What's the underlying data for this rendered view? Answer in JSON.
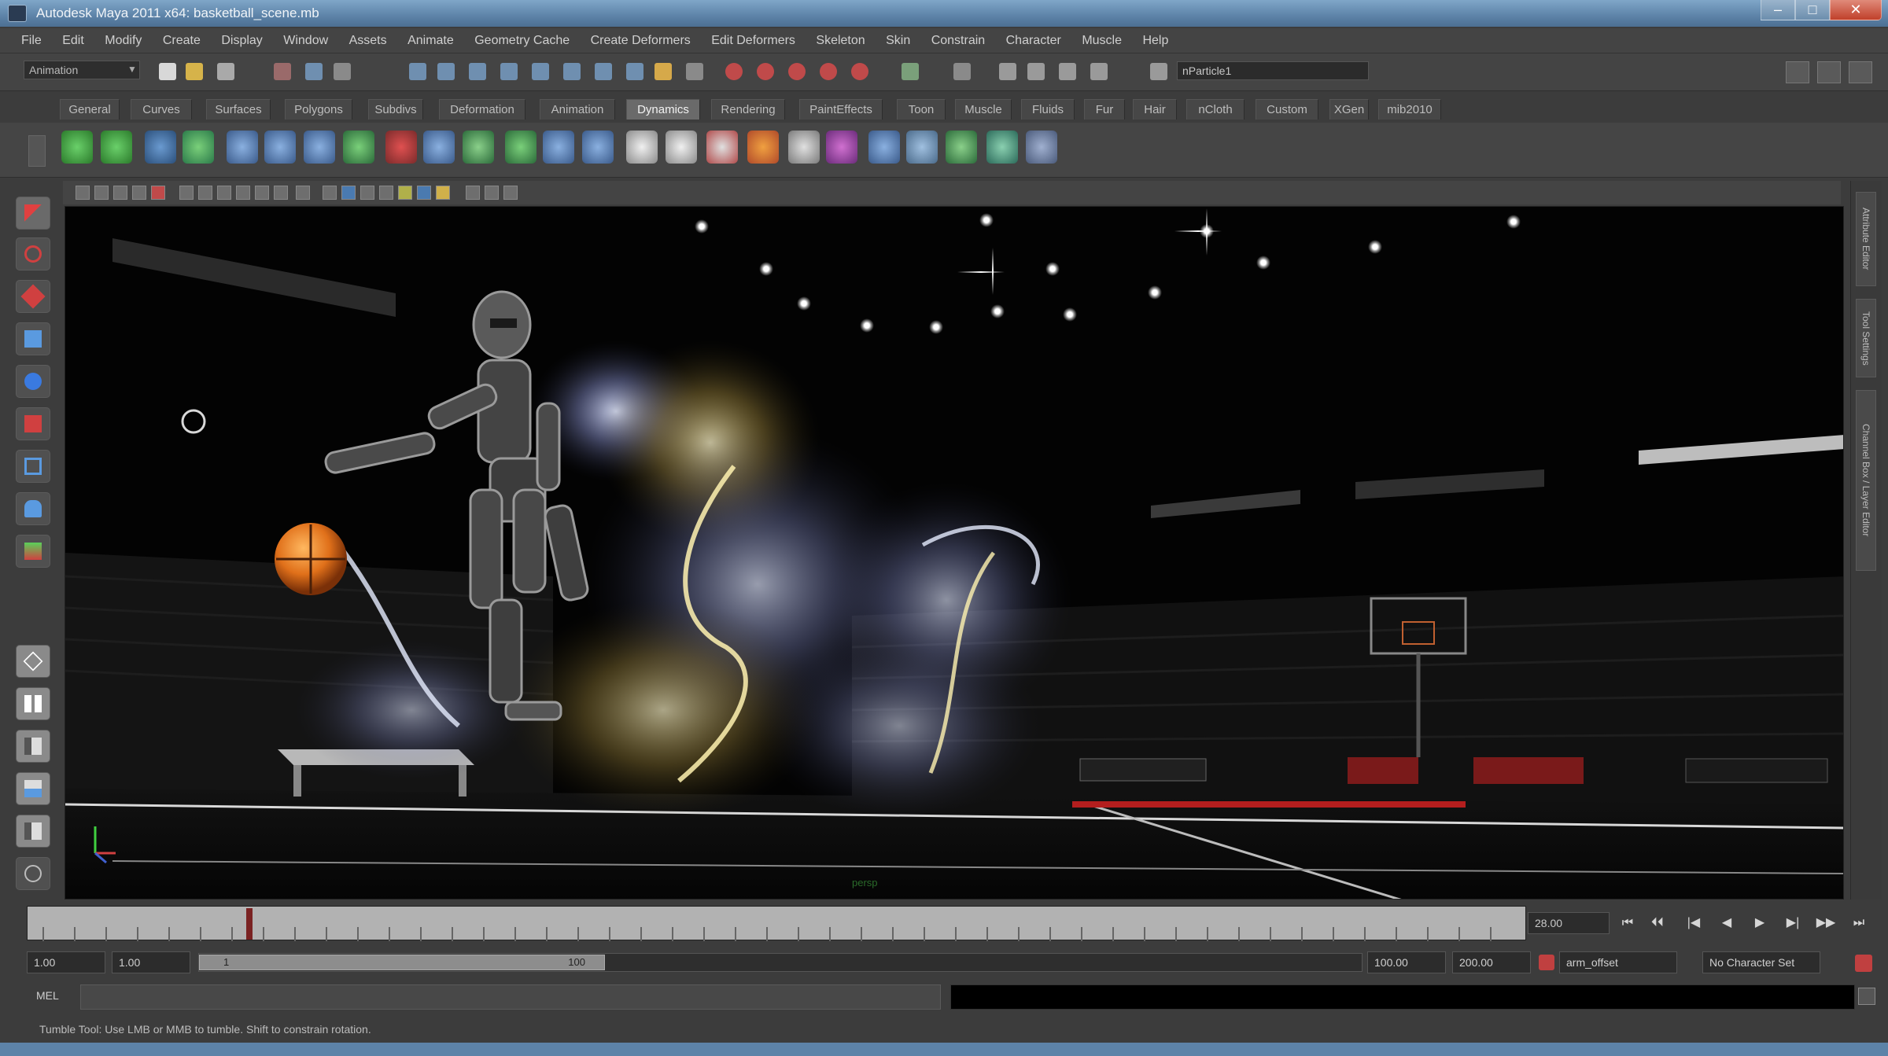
{
  "window": {
    "title": "Autodesk Maya 2011 x64: basketball_scene.mb",
    "minimize": "–",
    "maximize": "□",
    "close": "✕"
  },
  "menubar": [
    "File",
    "Edit",
    "Modify",
    "Create",
    "Display",
    "Window",
    "Assets",
    "Animate",
    "Geometry Cache",
    "Create Deformers",
    "Edit Deformers",
    "Skeleton",
    "Skin",
    "Constrain",
    "Character",
    "Muscle",
    "Help"
  ],
  "statusline": {
    "menuset": "Animation",
    "object_name": "nParticle1"
  },
  "shelf_tabs": [
    "General",
    "Curves",
    "Surfaces",
    "Polygons",
    "Subdivs",
    "Deformation",
    "Animation",
    "Dynamics",
    "Rendering",
    "PaintEffects",
    "Toon",
    "Muscle",
    "Fluids",
    "Fur",
    "Hair",
    "nCloth",
    "Custom",
    "XGen",
    "mib2010"
  ],
  "shelf_active_tab": "Dynamics",
  "viewport": {
    "hud_text": "persp"
  },
  "right_tabs": [
    "Attribute Editor",
    "Tool Settings",
    "Channel Box / Layer Editor"
  ],
  "timeslider": {
    "current_frame": "28.00",
    "playhead_fraction": 0.146
  },
  "range": {
    "anim_start": "1.00",
    "playback_start": "1.00",
    "range_start_label": "1",
    "range_end_label": "100",
    "playback_end": "100.00",
    "anim_end": "200.00",
    "anim_layer": "arm_offset",
    "character_set": "No Character Set"
  },
  "cmdline": {
    "label": "MEL"
  },
  "helpline": "Tumble Tool: Use LMB or MMB to tumble. Shift to constrain rotation.",
  "playback_buttons": [
    "⏮",
    "⏴⏴",
    "|◀",
    "◀",
    "▶",
    "▶|",
    "▶▶",
    "⏭"
  ],
  "colors": {
    "accent_red": "#c04040",
    "shelf_active": "#6a6a6a",
    "title_blue": "#5d83a8"
  }
}
